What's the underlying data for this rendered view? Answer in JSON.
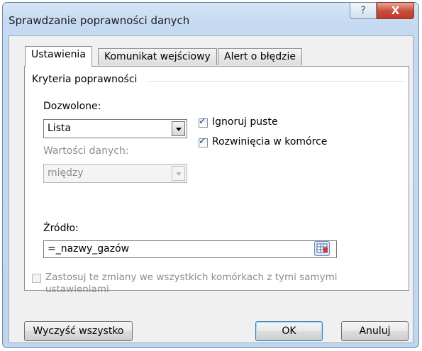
{
  "window": {
    "title": "Sprawdzanie poprawności danych",
    "help_glyph": "?",
    "close_glyph": "X"
  },
  "tabs": [
    {
      "label": "Ustawienia",
      "active": true
    },
    {
      "label": "Komunikat wejściowy",
      "active": false
    },
    {
      "label": "Alert o błędzie",
      "active": false
    }
  ],
  "criteria": {
    "group_label": "Kryteria poprawności",
    "allow_label": "Dozwolone:",
    "allow_value": "Lista",
    "data_label": "Wartości danych:",
    "data_value": "między",
    "ignore_blank_label": "Ignoruj puste",
    "ignore_blank_checked": true,
    "in_cell_dropdown_label": "Rozwinięcia w komórce",
    "in_cell_dropdown_checked": true,
    "source_label": "Źródło:",
    "source_value": "=_nazwy_gazów"
  },
  "apply_all": {
    "label_line1": "Zastosuj te zmiany we wszystkich komórkach z tymi samymi",
    "label_line2": "ustawieniami",
    "checked": false,
    "enabled": false
  },
  "buttons": {
    "clear_all": "Wyczyść wszystko",
    "ok": "OK",
    "cancel": "Anuluj"
  },
  "colors": {
    "title_bar": "#c5d9f1",
    "close_button": "#c74a38",
    "panel_bg": "#ffffff",
    "dialog_bg": "#f0f0f0",
    "check_mark": "#1b3f9c"
  },
  "icons": {
    "range_selector": "range-select-icon",
    "dropdown": "chevron-down-icon"
  }
}
